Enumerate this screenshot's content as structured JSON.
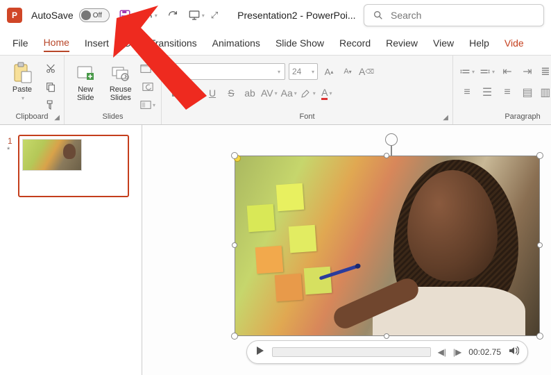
{
  "titlebar": {
    "autosave_label": "AutoSave",
    "autosave_state": "Off",
    "document_title": "Presentation2  -  PowerPoi...",
    "search_placeholder": "Search"
  },
  "tabs": {
    "file": "File",
    "home": "Home",
    "insert": "Insert",
    "draw": "Dr",
    "transitions": "Transitions",
    "animations": "Animations",
    "slideshow": "Slide Show",
    "record": "Record",
    "review": "Review",
    "view": "View",
    "help": "Help",
    "video": "Vide"
  },
  "ribbon": {
    "clipboard": {
      "label": "Clipboard",
      "paste": "Paste"
    },
    "slides": {
      "label": "Slides",
      "new_slide": "New\nSlide",
      "reuse": "Reuse\nSlides"
    },
    "font": {
      "label": "Font",
      "size_placeholder": "24"
    },
    "paragraph": {
      "label": "Paragraph"
    }
  },
  "thumbnails": {
    "slide1": {
      "number": "1",
      "marker": "*"
    }
  },
  "player": {
    "timecode": "00:02.75"
  }
}
